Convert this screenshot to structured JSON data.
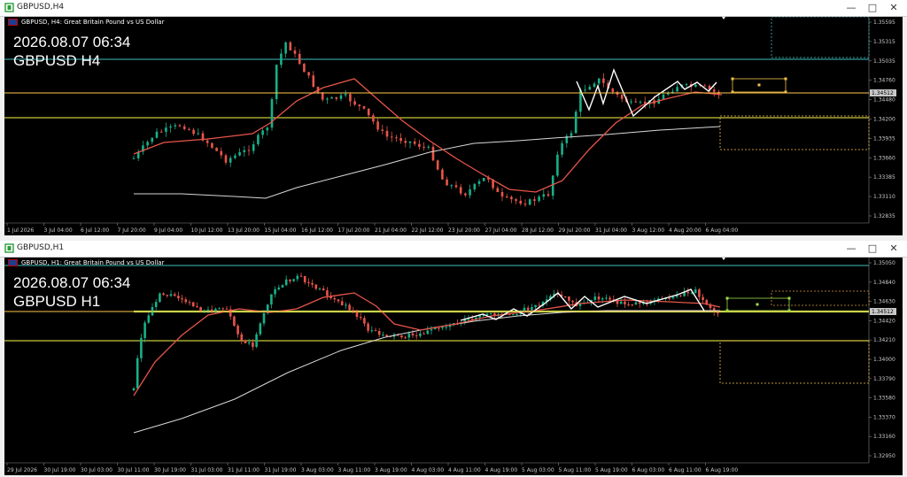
{
  "colors": {
    "background": "#000000",
    "price_line": "#ffc94a",
    "ma_red": "#e8554a",
    "ma_white": "#d8d8d8",
    "zigzag": "#ffffff",
    "level": "#c8c838",
    "teal": "#3fbfbf",
    "green": "#9bdc4a",
    "bull": "#18b08a",
    "bear": "#e8554a"
  },
  "windows": [
    {
      "title": "GBPUSD,H4",
      "symbol_line": "GBPUSD, H4:  Great Britain Pound vs US Dollar",
      "overlay_date": "2026.08.07 06:34",
      "overlay_symbol": "GBPUSD H4",
      "current_price": "1.34512",
      "price_ticks": [
        "1.35595",
        "1.35315",
        "1.35035",
        "1.34760",
        "1.34480",
        "1.34200",
        "1.33935",
        "1.33660",
        "1.33385",
        "1.33110",
        "1.32835"
      ],
      "time_ticks": [
        "1 Jul 2026",
        "3 Jul 04:00",
        "6 Jul 12:00",
        "7 Jul 20:00",
        "9 Jul 04:00",
        "10 Jul 12:00",
        "13 Jul 20:00",
        "15 Jul 04:00",
        "16 Jul 12:00",
        "17 Jul 20:00",
        "21 Jul 04:00",
        "22 Jul 12:00",
        "23 Jul 20:00",
        "27 Jul 04:00",
        "28 Jul 12:00",
        "29 Jul 20:00",
        "31 Jul 04:00",
        "3 Aug 12:00",
        "4 Aug 20:00",
        "6 Aug 04:00"
      ]
    },
    {
      "title": "GBPUSD,H1",
      "symbol_line": "GBPUSD, H1:  Great Britain Pound vs US Dollar",
      "overlay_date": "2026.08.07 06:34",
      "overlay_symbol": "GBPUSD H1",
      "current_price": "1.34512",
      "price_ticks": [
        "1.35050",
        "1.34840",
        "1.34630",
        "1.34420",
        "1.34210",
        "1.34000",
        "1.33790",
        "1.33580",
        "1.33370",
        "1.33160",
        "1.32950"
      ],
      "time_ticks": [
        "29 Jul 2026",
        "30 Jul 19:00",
        "30 Jul 03:00",
        "30 Jul 11:00",
        "30 Jul 19:00",
        "31 Jul 03:00",
        "31 Jul 11:00",
        "31 Jul 19:00",
        "3 Aug 03:00",
        "3 Aug 11:00",
        "3 Aug 19:00",
        "4 Aug 03:00",
        "4 Aug 11:00",
        "4 Aug 19:00",
        "5 Aug 03:00",
        "5 Aug 11:00",
        "5 Aug 19:00",
        "6 Aug 03:00",
        "6 Aug 11:00",
        "6 Aug 19:00"
      ]
    }
  ]
}
